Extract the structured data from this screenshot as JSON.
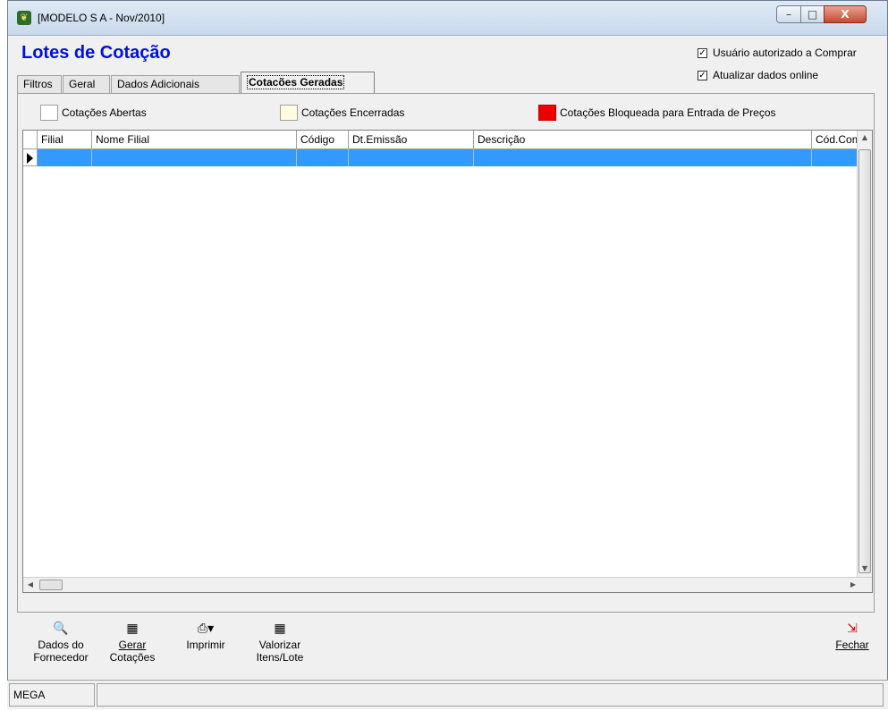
{
  "window": {
    "title": "[MODELO S A - Nov/2010]",
    "app_icon": "app-logo-icon",
    "controls": {
      "minimize": "–",
      "maximize": "□",
      "close": "X"
    }
  },
  "page": {
    "title": "Lotes de Cotação",
    "checkboxes": [
      {
        "label": "Usuário autorizado a Comprar",
        "checked": true
      },
      {
        "label": "Atualizar dados online",
        "checked": true
      }
    ]
  },
  "tabs": [
    {
      "label": "Filtros",
      "active": false
    },
    {
      "label": "Geral",
      "active": false
    },
    {
      "label": "Dados Adicionais",
      "active": false
    },
    {
      "label": "Cotacões Geradas",
      "active": true
    }
  ],
  "legend": [
    {
      "label": "Cotações Abertas",
      "color": "#ffffff"
    },
    {
      "label": "Cotações Encerradas",
      "color": "#fffde0"
    },
    {
      "label": "Cotações Bloqueada para Entrada de Preços",
      "color": "#ee0000"
    }
  ],
  "grid": {
    "columns": [
      "Filial",
      "Nome Filial",
      "Código",
      "Dt.Emissão",
      "Descrição",
      "Cód.Com"
    ],
    "selected_row_color": "#3399ff"
  },
  "toolbar": {
    "buttons": [
      {
        "label_line1": "Dados do",
        "label_line2": "Fornecedor",
        "icon": "supplier-search-icon"
      },
      {
        "label_line1": "Gerar",
        "label_line2": "Cotações",
        "icon": "calculator-icon"
      },
      {
        "label_line1": "Imprimir",
        "label_line2": "",
        "icon": "printer-icon"
      },
      {
        "label_line1": "Valorizar",
        "label_line2": "Itens/Lote",
        "icon": "calculator-icon"
      }
    ],
    "close_label": "Fechar",
    "close_icon": "exit-door-icon"
  },
  "status": {
    "text": "MEGA"
  }
}
